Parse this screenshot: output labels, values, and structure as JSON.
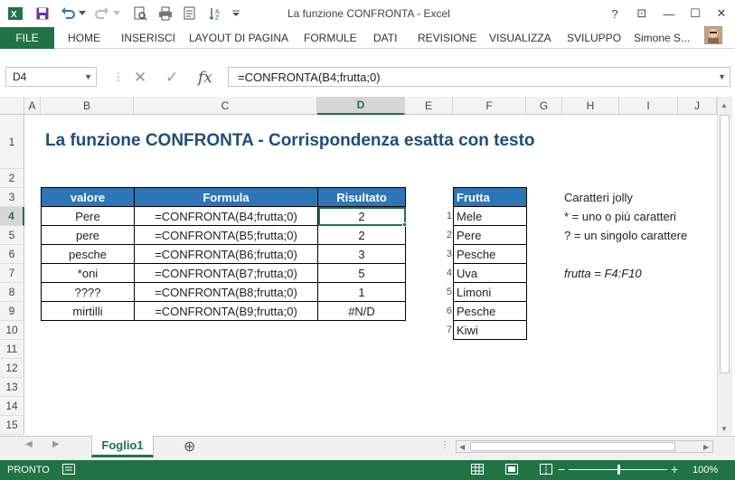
{
  "window": {
    "title": "La funzione CONFRONTA - Excel",
    "help": "?",
    "restore_ribbon": "⊡",
    "minimize": "—",
    "maximize": "☐",
    "close": "✕"
  },
  "ribbon": {
    "file": "FILE",
    "tabs": [
      "HOME",
      "INSERISCI",
      "LAYOUT DI PAGINA",
      "FORMULE",
      "DATI",
      "REVISIONE",
      "VISUALIZZA",
      "SVILUPPO"
    ],
    "user": "Simone S..."
  },
  "formula_bar": {
    "name_box": "D4",
    "cancel": "✕",
    "enter": "✓",
    "fx": "fx",
    "formula": "=CONFRONTA(B4;frutta;0)"
  },
  "columns": [
    "A",
    "B",
    "C",
    "D",
    "E",
    "F",
    "G",
    "H",
    "I",
    "J"
  ],
  "rows": [
    "1",
    "2",
    "3",
    "4",
    "5",
    "6",
    "7",
    "8",
    "9",
    "10",
    "11",
    "12",
    "13",
    "14",
    "15"
  ],
  "sheet": {
    "title": "La funzione CONFRONTA - Corrispondenza esatta con testo",
    "table": {
      "headers": [
        "valore",
        "Formula",
        "Risultato"
      ],
      "rows": [
        [
          "Pere",
          "=CONFRONTA(B4;frutta;0)",
          "2"
        ],
        [
          "pere",
          "=CONFRONTA(B5;frutta;0)",
          "2"
        ],
        [
          "pesche",
          "=CONFRONTA(B6;frutta;0)",
          "3"
        ],
        [
          "*oni",
          "=CONFRONTA(B7;frutta;0)",
          "5"
        ],
        [
          "????",
          "=CONFRONTA(B8;frutta;0)",
          "1"
        ],
        [
          "mirtilli",
          "=CONFRONTA(B9;frutta;0)",
          "#N/D"
        ]
      ]
    },
    "fruit_header": "Frutta",
    "fruit": [
      "Mele",
      "Pere",
      "Pesche",
      "Uva",
      "Limoni",
      "Pesche",
      "Kiwi"
    ],
    "fruit_index": [
      "1",
      "2",
      "3",
      "4",
      "5",
      "6",
      "7"
    ],
    "notes": {
      "jolly_title": "Caratteri jolly",
      "star": "* = uno o più caratteri",
      "question": "? = un singolo carattere",
      "named_range": "frutta = F4:F10"
    }
  },
  "sheet_tabs": {
    "active": "Foglio1",
    "add": "⊕"
  },
  "status": {
    "ready": "PRONTO",
    "zoom_minus": "−",
    "zoom_plus": "+",
    "zoom": "100%",
    "zoom_level": 0.5
  },
  "colors": {
    "excel_green": "#217346",
    "table_header_blue": "#2e75b6",
    "title_blue": "#1f4e79"
  }
}
